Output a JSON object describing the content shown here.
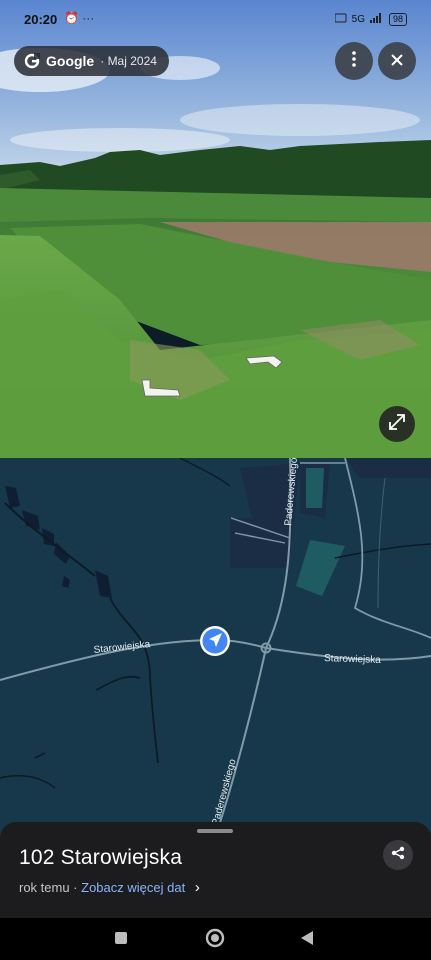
{
  "status_bar": {
    "time": "20:20",
    "left_icons": "⏰ ···",
    "network": "5G",
    "battery": "98"
  },
  "street_view": {
    "brand": "Google",
    "date": "· Maj 2024"
  },
  "map": {
    "road_starowiejska_left": "Starowiejska",
    "road_starowiejska_right": "Starowiejska",
    "road_paderewskiego_top": "Paderewskiego",
    "road_paderewskiego_bottom": "Paderewskiego"
  },
  "place_sheet": {
    "title": "102 Starowiejska",
    "age": "rok temu ·",
    "more_dates_link": "Zobacz więcej dat",
    "chevron": "›"
  },
  "colors": {
    "map_bg": "#17384a",
    "road": "#7f9aa8",
    "link": "#8ab4f8",
    "location_blue": "#4285f4"
  }
}
